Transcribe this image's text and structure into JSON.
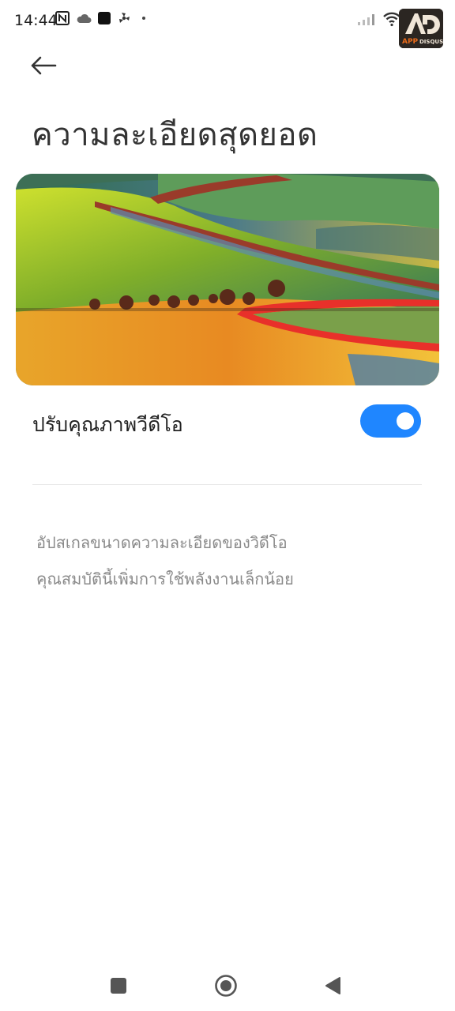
{
  "status_bar": {
    "time": "14:44",
    "left_icons": [
      "nfc-icon",
      "cloud-icon",
      "app-square-icon",
      "fan-icon",
      "dot-icon"
    ],
    "right_icons": [
      "signal-icon",
      "wifi-icon"
    ],
    "logo_text": "APPDISQUS"
  },
  "header": {
    "back_icon": "arrow-left-icon",
    "title": "ความละเอียดสุดยอด"
  },
  "setting": {
    "label": "ปรับคุณภาพวีดีโอ",
    "toggle_on": true,
    "accent_color": "#1f86ff"
  },
  "description": {
    "line1": "อัปสเกลขนาดความละเอียดของวิดีโอ",
    "line2": "คุณสมบัตินี้เพิ่มการใช้พลังงานเล็กน้อย"
  },
  "nav_bar": {
    "items": [
      "recents-square-icon",
      "home-circle-icon",
      "back-triangle-icon"
    ]
  }
}
